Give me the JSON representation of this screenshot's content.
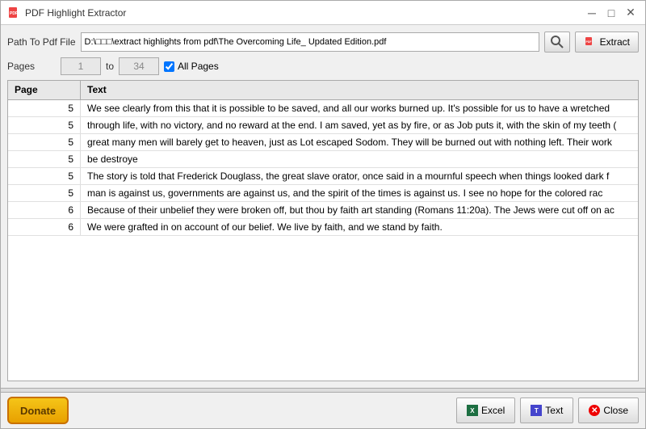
{
  "window": {
    "title": "PDF Highlight Extractor"
  },
  "titlebar": {
    "minimize": "─",
    "maximize": "□",
    "close": "✕"
  },
  "path_row": {
    "label": "Path To Pdf File",
    "value": "D:\\□□□\\extract highlights from pdf\\The Overcoming Life_ Updated Edition.pdf",
    "search_label": "🔍",
    "extract_label": "Extract"
  },
  "pages_row": {
    "label": "Pages",
    "from": "1",
    "to_label": "to",
    "to_value": "34",
    "allpages_label": "All Pages",
    "allpages_checked": true
  },
  "table": {
    "col_page": "Page",
    "col_text": "Text",
    "rows": [
      {
        "page": "5",
        "text": "We see clearly from this that it is possible to be saved, and all our works burned up. It's possible for us to have a wretched"
      },
      {
        "page": "5",
        "text": "through life, with no victory, and no reward at the end. I am saved, yet as by fire, or as Job puts it, with the skin of my teeth ("
      },
      {
        "page": "5",
        "text": "great many men will barely get to heaven, just as Lot escaped Sodom. They will be burned out with nothing left. Their work"
      },
      {
        "page": "5",
        "text": "be destroye"
      },
      {
        "page": "5",
        "text": "The story is told that Frederick Douglass, the great slave orator, once said in a mournful speech when things looked dark f"
      },
      {
        "page": "5",
        "text": "man is against us, governments are against us, and the spirit of the times is against us. I see no hope for the colored rac"
      },
      {
        "page": "6",
        "text": "Because of their unbelief they were broken off, but thou by faith art standing (Romans 11:20a). The Jews were cut off on ac"
      },
      {
        "page": "6",
        "text": "We were grafted in on account of our belief. We live by faith, and we stand by faith."
      }
    ]
  },
  "footer": {
    "donate_label": "Donate",
    "excel_label": "Excel",
    "text_label": "Text",
    "close_label": "Close"
  }
}
